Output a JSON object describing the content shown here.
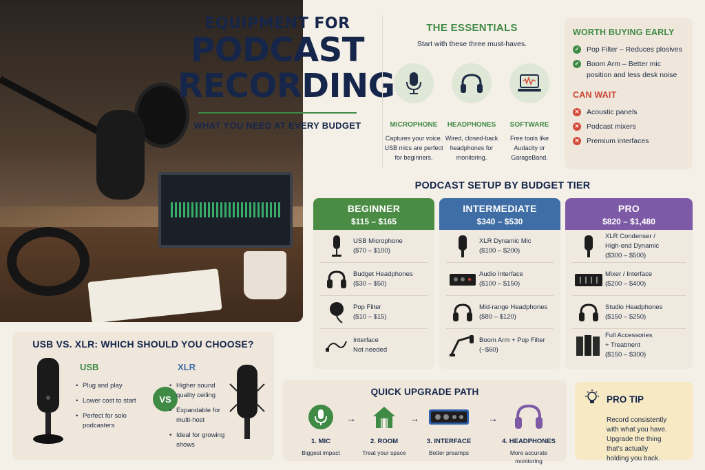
{
  "title": {
    "line1": "EQUIPMENT FOR",
    "line2": "PODCAST",
    "line3": "RECORDING",
    "subtitle": "WHAT YOU NEED AT EVERY BUDGET"
  },
  "essentials": {
    "title": "THE ESSENTIALS",
    "subtitle": "Start with these three must-haves.",
    "items": [
      {
        "name": "MICROPHONE",
        "desc1": "Captures your voice.",
        "desc2": "USB mics are perfect",
        "desc3": "for beginners.",
        "icon": "microphone-icon"
      },
      {
        "name": "HEADPHONES",
        "desc1": "Wired, closed-back",
        "desc2": "headphones for",
        "desc3": "monitoring.",
        "icon": "headphones-icon"
      },
      {
        "name": "SOFTWARE",
        "desc1": "Free tools like",
        "desc2": "Audacity or",
        "desc3": "GarageBand.",
        "icon": "laptop-waveform-icon"
      }
    ]
  },
  "worth_buying": {
    "title": "WORTH BUYING EARLY",
    "items": [
      "Pop Filter – Reduces plosives",
      "Boom Arm – Better mic position and less desk noise"
    ]
  },
  "can_wait": {
    "title": "CAN WAIT",
    "items": [
      "Acoustic panels",
      "Podcast mixers",
      "Premium interfaces"
    ]
  },
  "tiers": {
    "title": "PODCAST SETUP BY BUDGET TIER",
    "beginner": {
      "name": "BEGINNER",
      "price": "$115 – $165",
      "color": "#4a8c43",
      "rows": [
        {
          "l1": "USB Microphone",
          "l2": "($70 – $100)"
        },
        {
          "l1": "Budget Headphones",
          "l2": "($30 – $50)"
        },
        {
          "l1": "Pop Filter",
          "l2": "($10 – $15)"
        },
        {
          "l1": "Interface",
          "l2": "Not needed"
        }
      ]
    },
    "intermediate": {
      "name": "INTERMEDIATE",
      "price": "$340 – $530",
      "color": "#3f6ea6",
      "rows": [
        {
          "l1": "XLR Dynamic Mic",
          "l2": "($100 – $200)"
        },
        {
          "l1": "Audio Interface",
          "l2": "($100 – $150)"
        },
        {
          "l1": "Mid-range Headphones",
          "l2": "($80 – $120)"
        },
        {
          "l1": "Boom Arm + Pop Filter",
          "l2": "(~$60)"
        }
      ]
    },
    "pro": {
      "name": "PRO",
      "price": "$820 – $1,480",
      "color": "#7e5aa6",
      "rows": [
        {
          "l1": "XLR Condenser /",
          "l2": "High-end Dynamic",
          "l3": "($300 – $500)"
        },
        {
          "l1": "Mixer / Interface",
          "l2": "($200 – $400)"
        },
        {
          "l1": "Studio Headphones",
          "l2": "($150 – $250)"
        },
        {
          "l1": "Full Accessories",
          "l2": "+ Treatment",
          "l3": "($150 – $300)"
        }
      ]
    }
  },
  "usb_xlr": {
    "title": "USB VS. XLR: WHICH SHOULD YOU CHOOSE?",
    "vs": "VS",
    "usb": {
      "label": "USB",
      "items": [
        "Plug and play",
        "Lower cost to start",
        "Perfect for solo podcasters"
      ]
    },
    "xlr": {
      "label": "XLR",
      "items": [
        "Higher sound quality ceiling",
        "Expandable for multi-host",
        "Ideal for growing shows"
      ]
    }
  },
  "upgrade": {
    "title": "QUICK UPGRADE PATH",
    "steps": [
      {
        "name": "1. MIC",
        "l1": "Biggest impact",
        "l2": ""
      },
      {
        "name": "2. ROOM",
        "l1": "Treat your space",
        "l2": ""
      },
      {
        "name": "3. INTERFACE",
        "l1": "Better preamps",
        "l2": ""
      },
      {
        "name": "4. HEADPHONES",
        "l1": "More accurate",
        "l2": "monitoring"
      }
    ]
  },
  "tip": {
    "title": "PRO TIP",
    "l1": "Record consistently",
    "l2": "with what you have.",
    "l3": "Upgrade the thing",
    "l4": "that's actually",
    "l5": "holding you back."
  },
  "colors": {
    "green": "#3f8a45",
    "blue": "#3f6ea6",
    "purple": "#7e5aa6",
    "navy": "#15264a",
    "red": "#d44a3a"
  }
}
